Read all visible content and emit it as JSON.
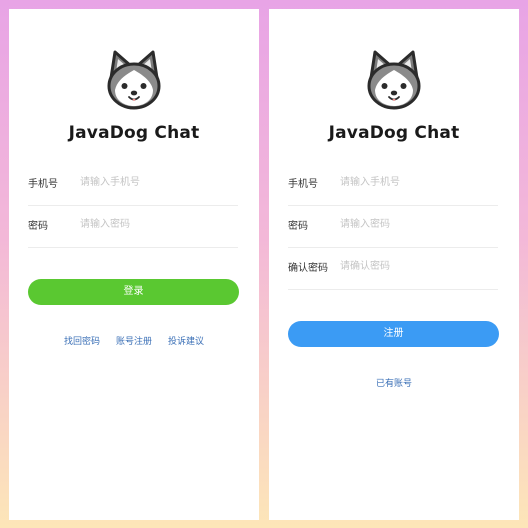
{
  "login": {
    "title": "JavaDog Chat",
    "phone_label": "手机号",
    "phone_placeholder": "请输入手机号",
    "password_label": "密码",
    "password_placeholder": "请输入密码",
    "submit_label": "登录",
    "links": [
      "找回密码",
      "账号注册",
      "投诉建议"
    ]
  },
  "register": {
    "title": "JavaDog Chat",
    "phone_label": "手机号",
    "phone_placeholder": "请输入手机号",
    "password_label": "密码",
    "password_placeholder": "请输入密码",
    "confirm_label": "确认密码",
    "confirm_placeholder": "请确认密码",
    "submit_label": "注册",
    "existing_account_link": "已有账号"
  },
  "icons": {
    "logo": "husky-dog-icon"
  },
  "colors": {
    "login_button": "#5ac831",
    "register_button": "#3b9bf4",
    "link": "#3a6fb6"
  }
}
